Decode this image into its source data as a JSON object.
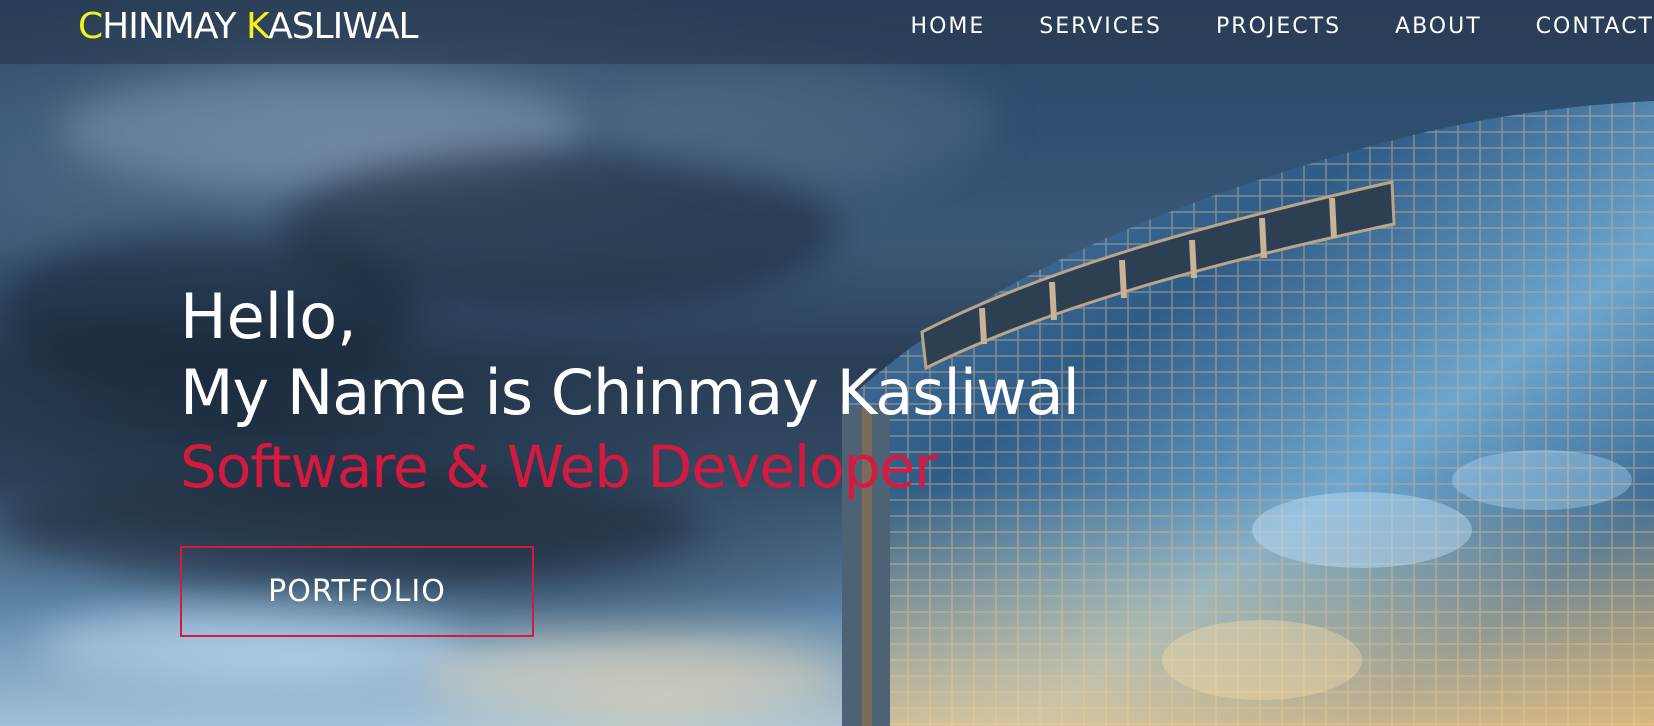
{
  "brand": {
    "first_initial": "C",
    "first_rest": "HINMAY ",
    "last_initial": "K",
    "last_rest": "ASLIWAL",
    "accent_color": "#f4f11c"
  },
  "nav": {
    "items": [
      {
        "label": "HOME"
      },
      {
        "label": "SERVICES"
      },
      {
        "label": "PROJECTS"
      },
      {
        "label": "ABOUT"
      },
      {
        "label": "CONTACT"
      }
    ]
  },
  "hero": {
    "greeting": "Hello,",
    "name_line": "My Name is Chinmay Kasliwal",
    "role": "Software & Web Developer",
    "role_color": "#d7193f",
    "cta_label": "PORTFOLIO",
    "background_image": "cloudy-sky-glass-office-building"
  }
}
